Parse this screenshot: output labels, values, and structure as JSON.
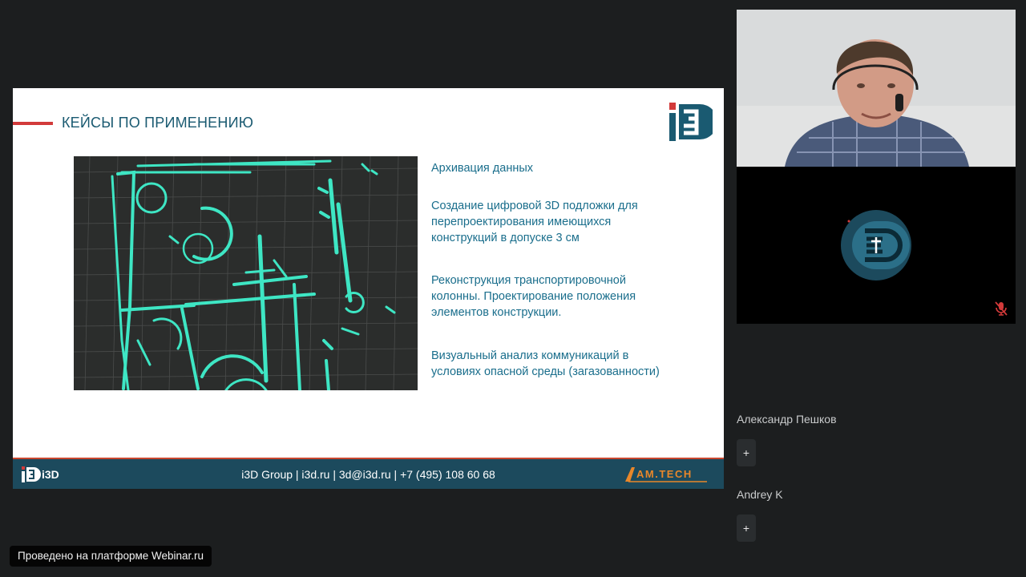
{
  "slide": {
    "title": "КЕЙСЫ ПО ПРИМЕНЕНИЮ",
    "logo_icon": "i3d-logo",
    "bullets": [
      "Архивация данных",
      "Создание цифровой 3D подложки для перепроектирования имеющихся конструкций в допуске 3 см",
      "Реконструкция транспортировочной колонны. Проектирование положения элементов конструкции.",
      "Визуальный анализ коммуникаций в условиях опасной среды (загазованности)"
    ],
    "footer": {
      "brand_icon": "i3d-footer-logo",
      "contacts": "i3D Group | i3d.ru | 3d@i3d.ru | +7 (495) 108 60 68",
      "partner_icon": "am-tech-logo"
    },
    "colors": {
      "title": "#1a5a71",
      "accent": "#d23a3a",
      "footer": "#1c4a5d",
      "scan": "#3ee6c4"
    }
  },
  "video": {
    "speaker_icon": "camera-feed",
    "logo_icon": "i3d-round-logo",
    "mic_icon": "mic-off-icon"
  },
  "participants": [
    {
      "name": "Александр Пешков",
      "action": "+"
    },
    {
      "name": "Andrey K",
      "action": "+"
    }
  ],
  "platform_badge": "Проведено на платформе Webinar.ru"
}
